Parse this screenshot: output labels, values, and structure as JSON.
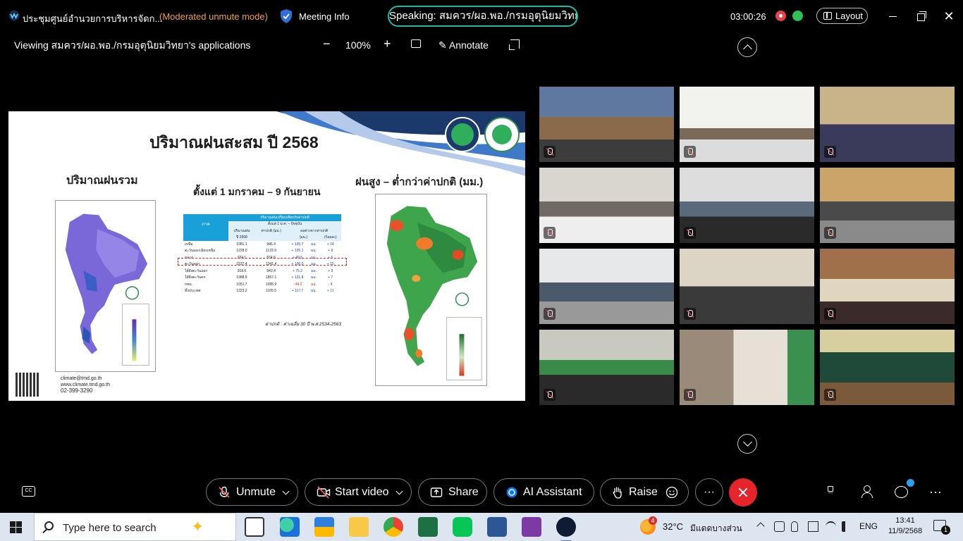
{
  "titlebar": {
    "meeting_title": "ประชุมศูนย์อำนวยการบริหารจัดก...",
    "mode": "(Moderated unmute mode)",
    "meeting_info": "Meeting Info",
    "speaking": "Speaking: สมควร/ผอ.พอ./กรมอุตุนิยมวิทยา",
    "timer": "03:00:26",
    "layout": "Layout",
    "close_glyph": "✕"
  },
  "share_toolbar": {
    "viewing": "Viewing สมควร/ผอ.พอ./กรมอุตุนิยมวิทยา's applications",
    "zoom_minus": "−",
    "zoom": "100%",
    "zoom_plus": "+",
    "annotate": "Annotate",
    "annotate_glyph": "✎"
  },
  "slide": {
    "title": "ปริมาณฝนสะสม ปี 2568",
    "left_map_title": "ปริมาณฝนรวม",
    "date_range": "ตั้งแต่ 1 มกราคม – 9 กันยายน",
    "right_map_title": "ฝนสูง – ต่ำกว่าค่าปกติ (มม.)",
    "table": {
      "header_region": "ภาค",
      "header_top": "ปริมาณฝนเปรียบเทียบกับค่าปกติ",
      "header_period": "ตั้งแต่ 1 ม.ค. – ปัจจุบัน",
      "col_rain": "ปริมาณฝน",
      "col_year": "ปี 2568",
      "col_normal": "ค่าปกติ (มม.)",
      "col_diff": "ผลต่างจากค่าปกติ",
      "col_mm": "(มม.)",
      "col_pct": "(ร้อยละ)",
      "rows": [
        {
          "region": "เหนือ",
          "rain": "1081.1",
          "normal": "946.4",
          "diff": "+ 135.7",
          "unit": "มม.",
          "pct": "+ 14",
          "sign": "pos"
        },
        {
          "region": "ตะวันออกเฉียงเหนือ",
          "rain": "1228.0",
          "normal": "1122.9",
          "diff": "+ 105.1",
          "unit": "มม.",
          "pct": "+ 9",
          "sign": "pos"
        },
        {
          "region": "กลาง",
          "rain": "924.1",
          "normal": "874.6",
          "diff": "+ 49.5",
          "unit": "มม.",
          "pct": "+ 6",
          "sign": "pos"
        },
        {
          "region": "ตะวันออก",
          "rain": "1537.4",
          "normal": "1341.4",
          "diff": "+ 196.0",
          "unit": "มม.",
          "pct": "+ 15",
          "sign": "pos"
        },
        {
          "region": "ใต้ฝั่งตะวันออก",
          "rain": "918.6",
          "normal": "843.4",
          "diff": "+ 75.2",
          "unit": "มม.",
          "pct": "+ 9",
          "sign": "pos"
        },
        {
          "region": "ใต้ฝั่งตะวันตก",
          "rain": "1988.9",
          "normal": "1857.1",
          "diff": "+ 131.8",
          "unit": "มม.",
          "pct": "+ 7",
          "sign": "pos"
        },
        {
          "region": "กทม.",
          "rain": "1051.7",
          "normal": "1095.9",
          "diff": "- 44.2",
          "unit": "มม.",
          "pct": "- 4",
          "sign": "neg"
        },
        {
          "region": "ทั้งประเทศ",
          "rain": "1223.2",
          "normal": "1105.5",
          "diff": "+ 117.7",
          "unit": "มม.",
          "pct": "+ 11",
          "sign": "pos"
        }
      ]
    },
    "pct_unit": "%",
    "note": "ค่าปกติ : ค่าเฉลี่ย 30 ปี พ.ศ.2534-2563",
    "contact_email": "climate@tmd.go.th",
    "contact_web": "www.climate.tmd.go.th",
    "contact_phone": "02-399-3290"
  },
  "controls": {
    "cc": "CC",
    "unmute": "Unmute",
    "start_video": "Start video",
    "share": "Share",
    "ai": "AI Assistant",
    "raise": "Raise",
    "more": "···",
    "dots": "···"
  },
  "taskbar": {
    "search_placeholder": "Type here to search",
    "spark": "✦",
    "weather_badge": "4",
    "temp": "32°C",
    "weather": "มีแดดบางส่วน",
    "lang": "ENG",
    "time": "13:41",
    "date": "11/9/2568",
    "notif_count": "1"
  },
  "colors": {
    "accent_teal": "#1fb7a8",
    "moderated": "#f0a13a",
    "leave": "#e5242b",
    "rec": "#e8414b"
  }
}
